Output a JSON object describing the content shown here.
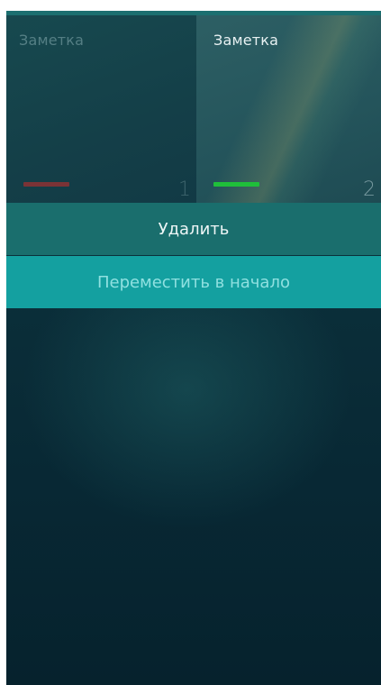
{
  "notes": [
    {
      "title": "Заметка",
      "number": "1",
      "color": "#7a3336"
    },
    {
      "title": "Заметка",
      "number": "2",
      "color": "#1fbf3a"
    }
  ],
  "context_menu": {
    "delete_label": "Удалить",
    "move_to_top_label": "Переместить в начало"
  },
  "colors": {
    "accent": "#14a0a0",
    "menu_background": "#1a6e6d"
  }
}
